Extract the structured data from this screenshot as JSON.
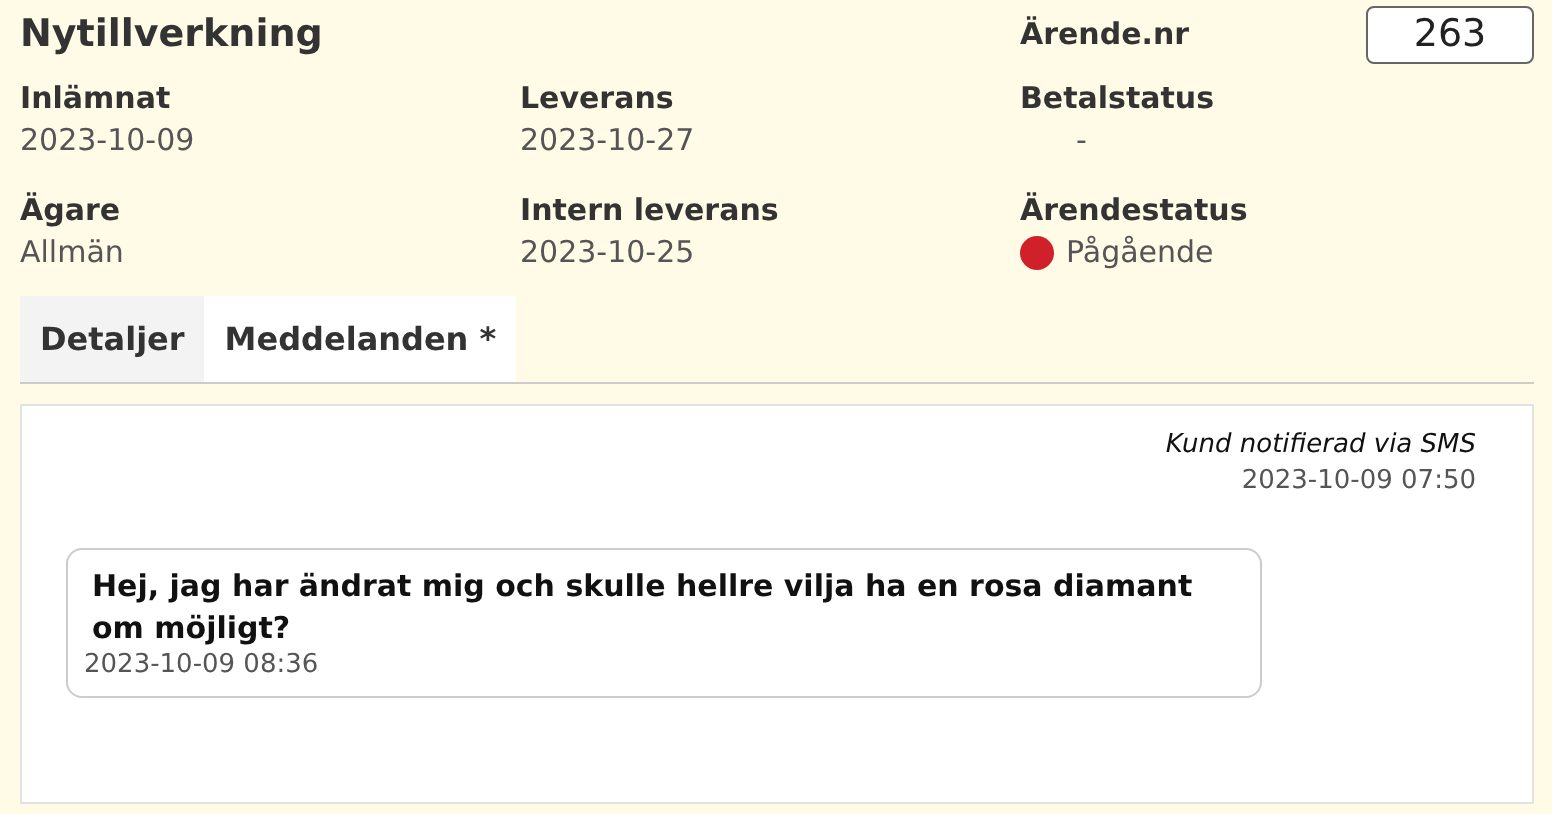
{
  "header": {
    "title": "Nytillverkning",
    "case_number_label": "Ärende.nr",
    "case_number": "263"
  },
  "fields": [
    {
      "label": "Inlämnat",
      "value": "2023-10-09"
    },
    {
      "label": "Leverans",
      "value": "2023-10-27"
    },
    {
      "label": "Betalstatus",
      "value": "-",
      "kind": "indented"
    },
    {
      "label": "Ägare",
      "value": "Allmän"
    },
    {
      "label": "Intern leverans",
      "value": "2023-10-25"
    },
    {
      "label": "Ärendestatus",
      "value": "Pågående",
      "kind": "status",
      "color": "#d0202a"
    }
  ],
  "tabs": [
    {
      "label": "Detaljer",
      "selected": false
    },
    {
      "label": "Meddelanden *",
      "selected": true
    }
  ],
  "messages": [
    {
      "kind": "system",
      "text": "Kund notifierad via SMS",
      "time": "2023-10-09 07:50"
    },
    {
      "kind": "customer",
      "text": "Hej, jag har ändrat mig och skulle hellre vilja ha en rosa diamant om möjligt?",
      "time": "2023-10-09 08:36"
    }
  ]
}
